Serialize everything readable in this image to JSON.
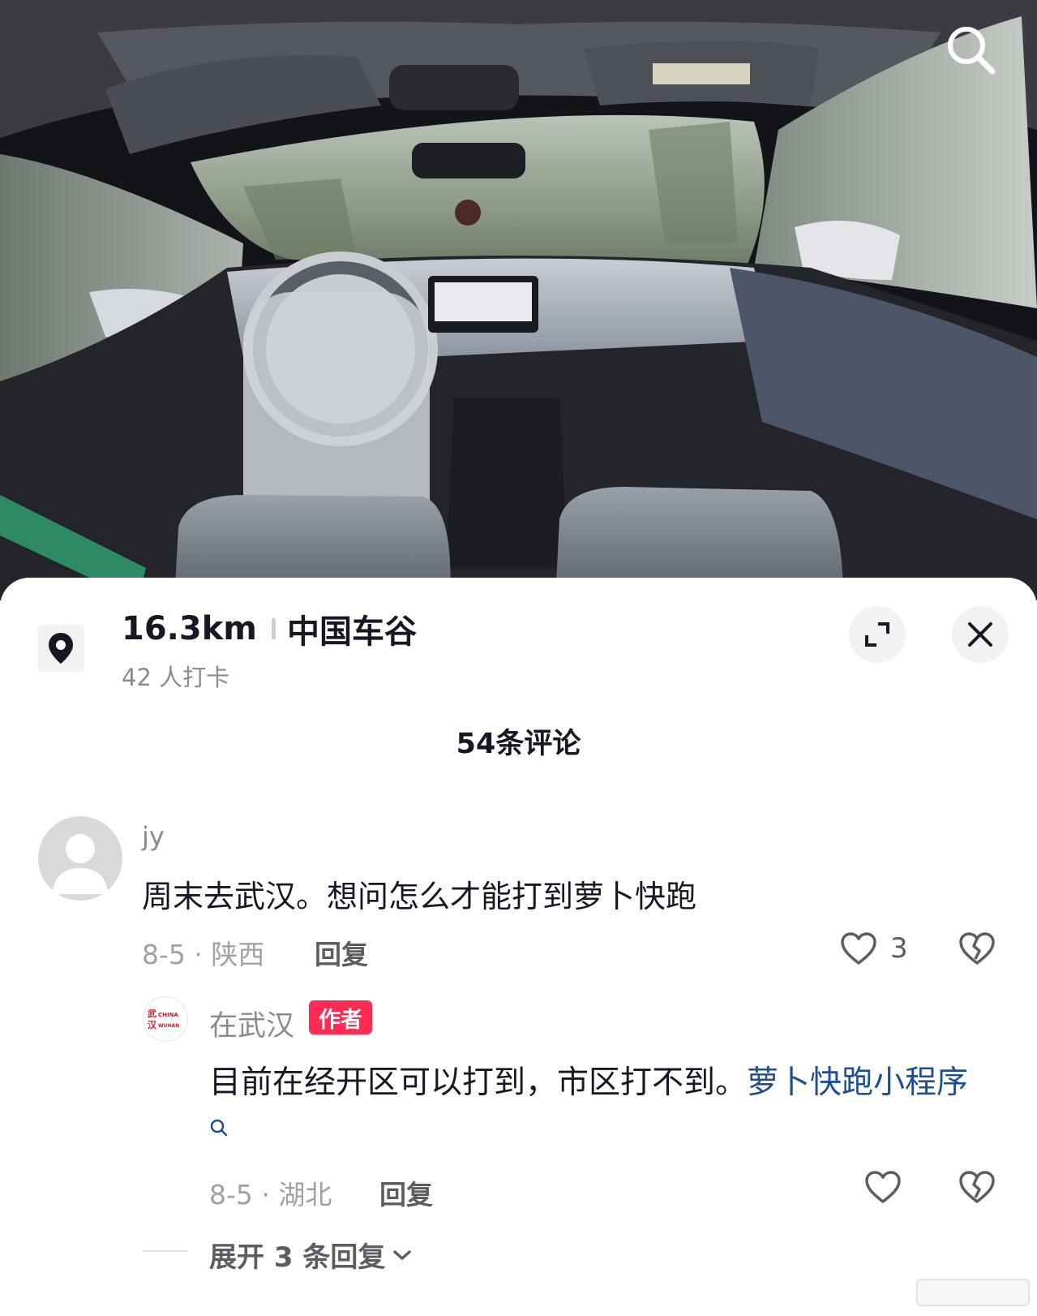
{
  "location": {
    "distance": "16.3km",
    "name": "中国车谷",
    "checkins": "42 人打卡"
  },
  "comments_header": "54条评论",
  "comments": [
    {
      "username": "jy",
      "text": "周末去武汉。想问怎么才能打到萝卜快跑",
      "date_region": "8-5 · 陕西",
      "reply_label": "回复",
      "likes": "3"
    }
  ],
  "reply": {
    "username": "在武汉",
    "badge": "作者",
    "text_plain": "目前在经开区可以打到，市区打不到。",
    "text_link": "萝卜快跑小程序",
    "date_region": "8-5 · 湖北",
    "reply_label": "回复",
    "avatar_text_top": "武CHINA",
    "avatar_text_bottom": "汉WUHAN"
  },
  "expand_replies": "展开 3 条回复",
  "colors": {
    "author_badge": "#fe2c55",
    "link": "#1f4f8f",
    "secondary_text": "#8a8b91"
  },
  "icons": [
    "search-icon",
    "location-pin-icon",
    "expand-icon",
    "close-icon",
    "heart-icon",
    "dislike-heart-icon",
    "chevron-down-icon"
  ]
}
